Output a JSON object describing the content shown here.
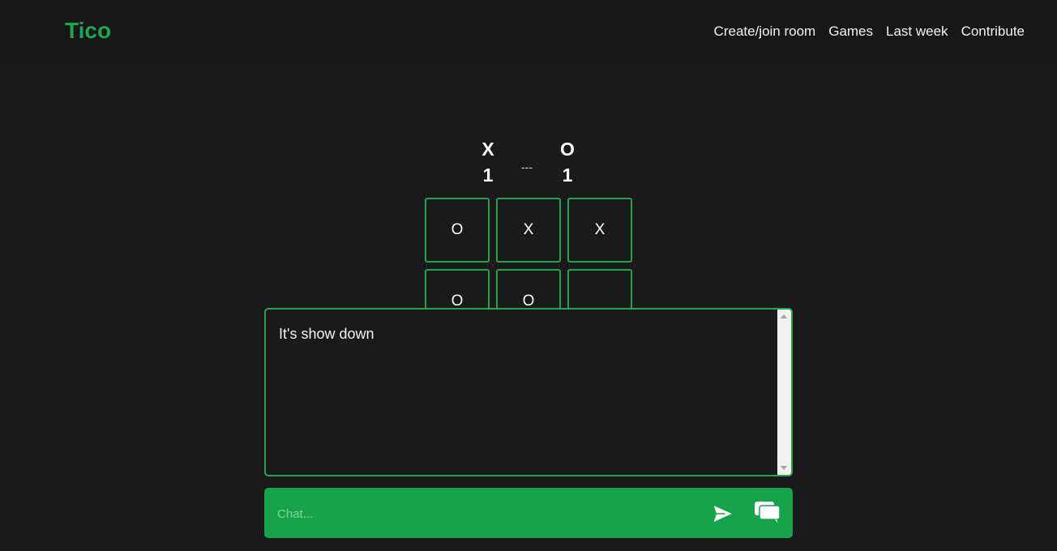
{
  "nav": {
    "brand": "Tico",
    "links": [
      "Create/join room",
      "Games",
      "Last week",
      "Contribute"
    ]
  },
  "score": {
    "x_label": "X",
    "x_score": "1",
    "separator": "---",
    "o_label": "O",
    "o_score": "1"
  },
  "board": {
    "cells": [
      "O",
      "X",
      "X",
      "O",
      "O",
      ""
    ]
  },
  "chat": {
    "messages": [
      "It's show down"
    ],
    "input_placeholder": "Chat..."
  },
  "colors": {
    "accent": "#1fa64d",
    "chat_bar": "#16a34a",
    "background": "#1a1a1c"
  },
  "icons": {
    "send": "send-icon",
    "chats": "chat-bubbles-icon"
  }
}
